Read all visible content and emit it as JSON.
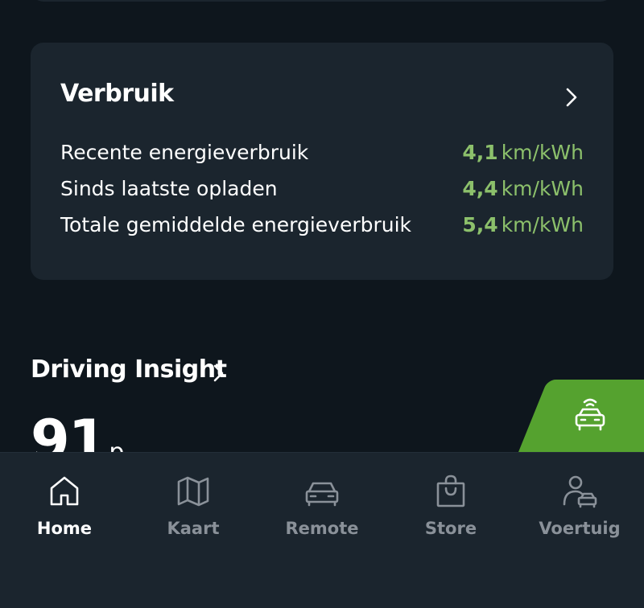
{
  "consumption": {
    "title": "Verbruik",
    "rows": [
      {
        "label": "Recente energieverbruik",
        "value": "4,1",
        "unit": "km/kWh"
      },
      {
        "label": "Sinds laatste opladen",
        "value": "4,4",
        "unit": "km/kWh"
      },
      {
        "label": "Totale gemiddelde energieverbruik",
        "value": "5,4",
        "unit": "km/kWh"
      }
    ]
  },
  "driving_insight": {
    "title": "Driving Insight",
    "score": "91",
    "score_unit": "p"
  },
  "colors": {
    "accent_green": "#8cc06b",
    "tab_green": "#55a22f"
  },
  "nav": {
    "items": [
      {
        "label": "Home",
        "icon": "home-icon",
        "active": true
      },
      {
        "label": "Kaart",
        "icon": "map-icon",
        "active": false
      },
      {
        "label": "Remote",
        "icon": "car-icon",
        "active": false
      },
      {
        "label": "Store",
        "icon": "shopping-bag-icon",
        "active": false
      },
      {
        "label": "Voertuig",
        "icon": "user-car-icon",
        "active": false
      }
    ]
  }
}
